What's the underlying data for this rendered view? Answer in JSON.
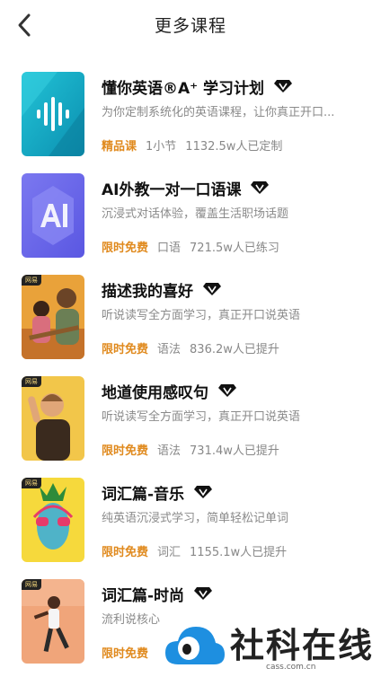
{
  "header": {
    "title": "更多课程"
  },
  "courses": [
    {
      "name": "懂你英语®A⁺ 学习计划",
      "desc": "为你定制系统化的英语课程，让你真正开口...",
      "badge": "精品课",
      "category": "1小节",
      "count": "1132.5w人已定制",
      "tag": ""
    },
    {
      "name": "AI外教一对一口语课",
      "desc": "沉浸式对话体验，覆盖生活职场话题",
      "badge": "限时免费",
      "category": "口语",
      "count": "721.5w人已练习",
      "tag": ""
    },
    {
      "name": "描述我的喜好",
      "desc": "听说读写全方面学习，真正开口说英语",
      "badge": "限时免费",
      "category": "语法",
      "count": "836.2w人已提升",
      "tag": "网易"
    },
    {
      "name": "地道使用感叹句",
      "desc": "听说读写全方面学习，真正开口说英语",
      "badge": "限时免费",
      "category": "语法",
      "count": "731.4w人已提升",
      "tag": "网易"
    },
    {
      "name": "词汇篇-音乐",
      "desc": "纯英语沉浸式学习，简单轻松记单词",
      "badge": "限时免费",
      "category": "词汇",
      "count": "1155.1w人已提升",
      "tag": "网易"
    },
    {
      "name": "词汇篇-时尚",
      "desc": "流利说核心",
      "badge": "限时免费",
      "category": "",
      "count": "",
      "tag": "网易"
    }
  ],
  "watermark": {
    "text": "社科在线",
    "sub": "cass.com.cn"
  },
  "colors": {
    "accent": "#e08a1e",
    "text": "#111111",
    "muted": "#8a8a8a"
  }
}
